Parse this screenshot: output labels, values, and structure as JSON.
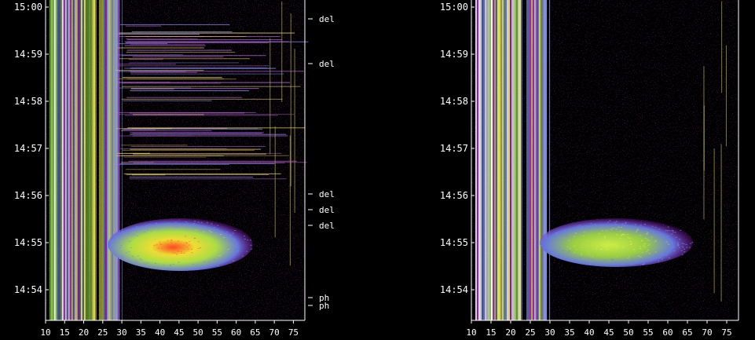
{
  "chart_data": [
    {
      "type": "heatmap",
      "panel": "left",
      "y_ticks": [
        "14:54",
        "14:55",
        "14:56",
        "14:57",
        "14:58",
        "14:59",
        "15:00"
      ],
      "x_ticks": [
        10,
        15,
        20,
        25,
        30,
        35,
        40,
        45,
        50,
        55,
        60,
        65,
        70,
        75
      ],
      "xlim": [
        10,
        78
      ],
      "ylim_minutes": [
        53.35,
        60.15
      ],
      "annotations": [
        {
          "label": "del",
          "time": "14:59:45"
        },
        {
          "label": "del",
          "time": "14:58:48"
        },
        {
          "label": "del",
          "time": "14:56:02"
        },
        {
          "label": "del",
          "time": "14:55:42"
        },
        {
          "label": "del",
          "time": "14:55:22"
        },
        {
          "label": "ph",
          "time": "14:53:50"
        },
        {
          "label": "ph",
          "time": "14:53:40"
        }
      ],
      "features": {
        "burst": {
          "x_range": [
            28,
            66
          ],
          "time_range": [
            "14:54:30",
            "14:55:25"
          ]
        },
        "bright_bands": [
          [
            11,
            23
          ],
          [
            24,
            29
          ]
        ],
        "interference_period": [
          "14:56:20",
          "14:59:40"
        ]
      }
    },
    {
      "type": "heatmap",
      "panel": "right",
      "y_ticks": [
        "14:54",
        "14:55",
        "14:56",
        "14:57",
        "14:58",
        "14:59",
        "15:00"
      ],
      "x_ticks": [
        10,
        15,
        20,
        25,
        30,
        35,
        40,
        45,
        50,
        55,
        60,
        65,
        70,
        75
      ],
      "xlim": [
        10,
        78
      ],
      "ylim_minutes": [
        53.35,
        60.15
      ],
      "annotations": [],
      "features": {
        "burst": {
          "x_range": [
            29,
            68
          ],
          "time_range": [
            "14:54:35",
            "14:55:25"
          ]
        },
        "bright_bands": [
          [
            11,
            23
          ],
          [
            24,
            29
          ]
        ]
      }
    }
  ],
  "colors": {
    "low": "#aa00cc",
    "mid": "#6677dd",
    "high": "#ccee44",
    "peak": "#ff3300",
    "background": "#000000"
  }
}
